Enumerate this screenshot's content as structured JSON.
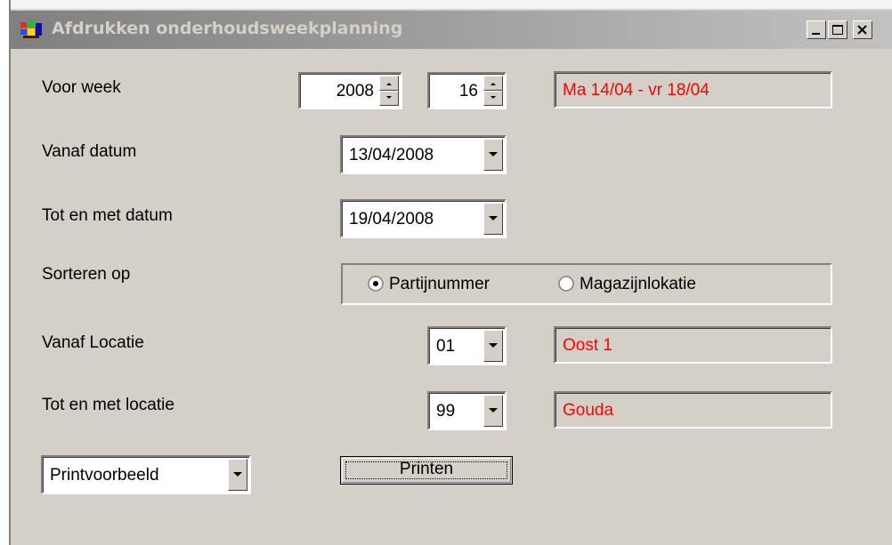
{
  "window": {
    "title": "Afdrukken onderhoudsweekplanning",
    "icon": "app-windows-icon",
    "buttons": {
      "minimize": "minimize-icon",
      "maximize": "maximize-icon",
      "close": "close-icon"
    }
  },
  "form": {
    "week": {
      "label": "Voor week",
      "year": "2008",
      "week_number": "16",
      "range_text": "Ma 14/04 - vr 18/04"
    },
    "from_date": {
      "label": "Vanaf datum",
      "value": "13/04/2008"
    },
    "to_date": {
      "label": "Tot en met datum",
      "value": "19/04/2008"
    },
    "sort": {
      "label": "Sorteren op",
      "options": [
        {
          "label": "Partijnummer",
          "selected": true
        },
        {
          "label": "Magazijnlokatie",
          "selected": false
        }
      ]
    },
    "from_location": {
      "label": "Vanaf Locatie",
      "code": "01",
      "name": "Oost 1"
    },
    "to_location": {
      "label": "Tot en met locatie",
      "code": "99",
      "name": "Gouda"
    },
    "output": {
      "selected": "Printvoorbeeld"
    },
    "print_button": {
      "label": "Printen"
    }
  },
  "colors": {
    "face": "#d4d0c8",
    "readonly_text": "#ff0000",
    "titlebar_gradient": [
      "#808080",
      "#c2c2c2"
    ]
  }
}
